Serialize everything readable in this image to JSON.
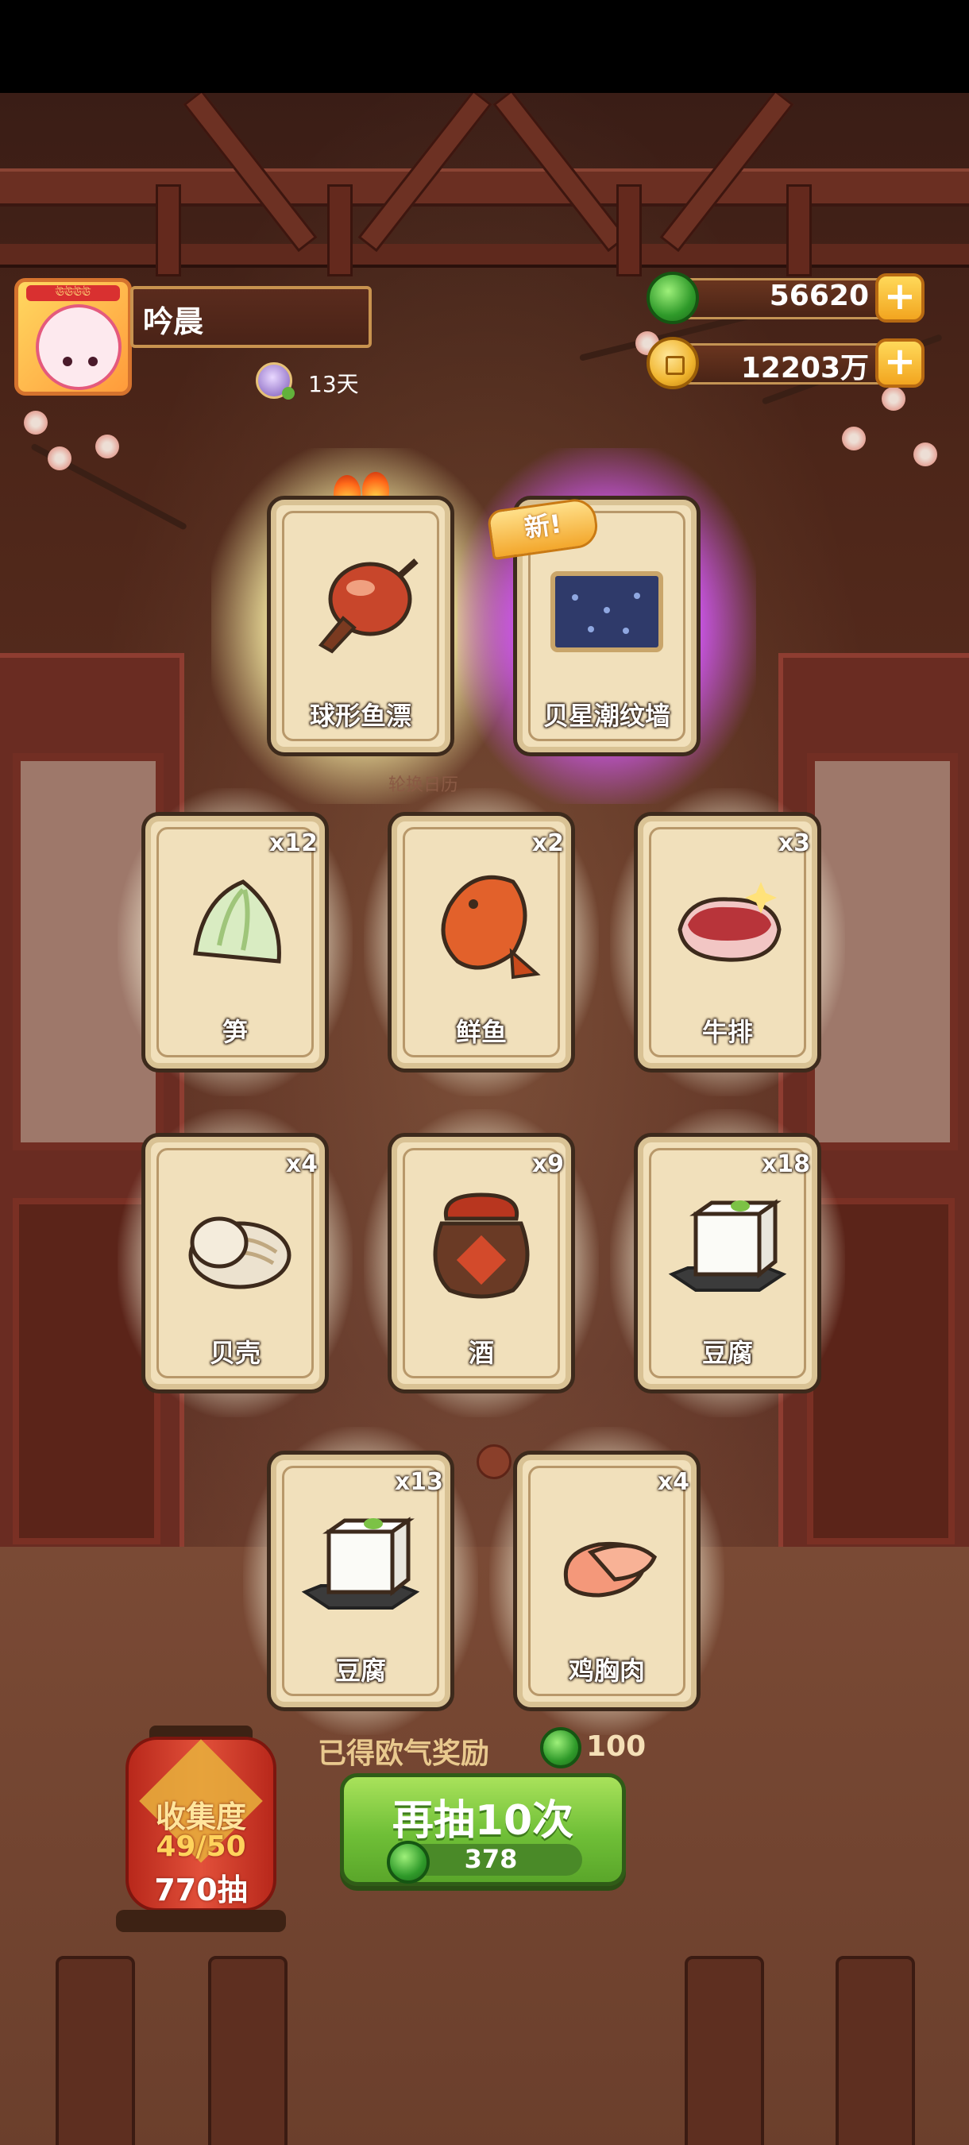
{
  "player": {
    "name": "吟晨",
    "days": "13天",
    "avatar_badge": "ঊঊঊঊ"
  },
  "currencies": [
    {
      "name": "jade",
      "value": "56620",
      "plus": "+"
    },
    {
      "name": "coin",
      "value": "12203万",
      "plus": "+"
    }
  ],
  "featured_cards": [
    {
      "label": "球形鱼漂",
      "highlight": "gold",
      "hot": true
    },
    {
      "label": "贝星潮纹墙",
      "highlight": "purple",
      "badge": "新!"
    }
  ],
  "rotation_label": "轮换日历",
  "cards": [
    {
      "label": "笋",
      "count": "x12"
    },
    {
      "label": "鲜鱼",
      "count": "x2"
    },
    {
      "label": "牛排",
      "count": "x3"
    },
    {
      "label": "贝壳",
      "count": "x4"
    },
    {
      "label": "酒",
      "count": "x9"
    },
    {
      "label": "豆腐",
      "count": "x18"
    },
    {
      "label": "豆腐",
      "count": "x13"
    },
    {
      "label": "鸡胸肉",
      "count": "x4"
    }
  ],
  "reward": {
    "text": "已得欧气奖励",
    "amount": "100"
  },
  "draw_button": {
    "label": "再抽10次",
    "cost": "378"
  },
  "collection": {
    "title": "收集度",
    "progress": "49/50",
    "draws": "770抽"
  },
  "colors": {
    "jade": "#2f9a2a",
    "coin": "#f0b52e",
    "button_green": "#6fbf37"
  }
}
